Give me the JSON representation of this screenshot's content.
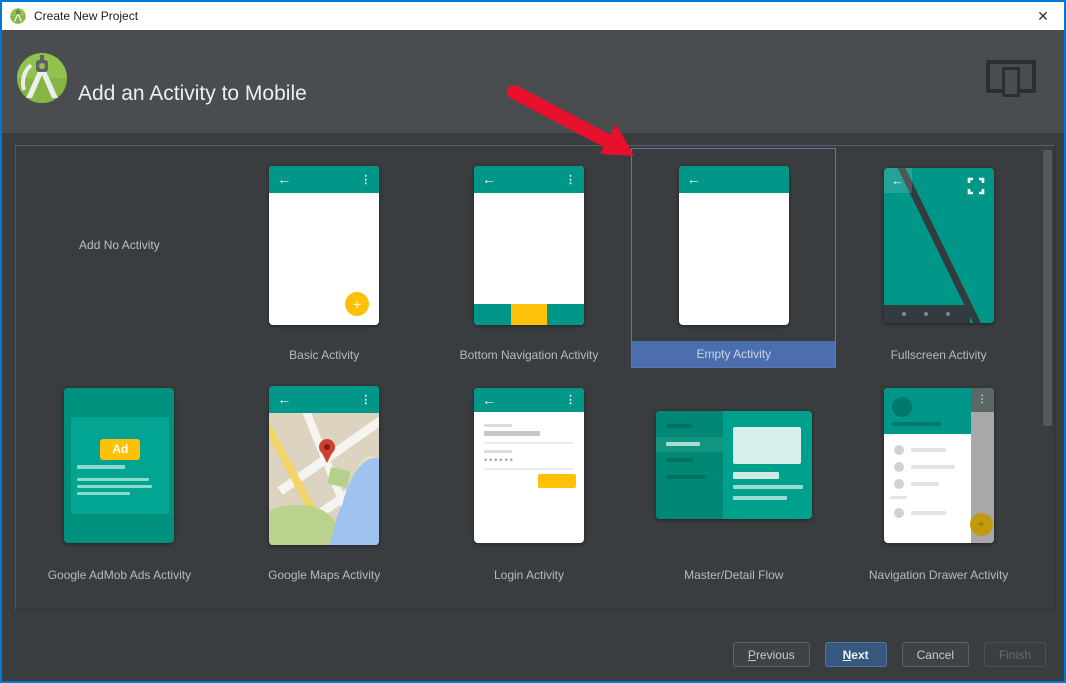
{
  "window": {
    "title": "Create New Project",
    "close_glyph": "✕"
  },
  "header": {
    "title": "Add an Activity to Mobile"
  },
  "icons": {
    "back": "←",
    "menu": "⋮",
    "plus": "+",
    "password_dots": "••••••"
  },
  "activities": {
    "row1": [
      {
        "label": "Add No Activity",
        "selected": false
      },
      {
        "label": "Basic Activity",
        "selected": false
      },
      {
        "label": "Bottom Navigation Activity",
        "selected": false
      },
      {
        "label": "Empty Activity",
        "selected": true
      },
      {
        "label": "Fullscreen Activity",
        "selected": false
      }
    ],
    "row2": [
      {
        "label": "Google AdMob Ads Activity",
        "selected": false
      },
      {
        "label": "Google Maps Activity",
        "selected": false
      },
      {
        "label": "Login Activity",
        "selected": false
      },
      {
        "label": "Master/Detail Flow",
        "selected": false
      },
      {
        "label": "Navigation Drawer Activity",
        "selected": false
      }
    ]
  },
  "thumbnails": {
    "ad_button_label": "Ad"
  },
  "buttons": {
    "previous": {
      "mnemonic": "P",
      "rest": "revious"
    },
    "next": {
      "mnemonic": "N",
      "rest": "ext"
    },
    "cancel": "Cancel",
    "finish": "Finish"
  },
  "colors": {
    "accent_teal": "#009688",
    "accent_yellow": "#ffc107",
    "selection_blue": "#4b6eaf",
    "selection_border": "#5d74b0",
    "annotation_red": "#e8112d",
    "window_border_blue": "#0078d7",
    "header_gray": "#4a4d4f",
    "panel_gray": "#3a3d3f"
  }
}
